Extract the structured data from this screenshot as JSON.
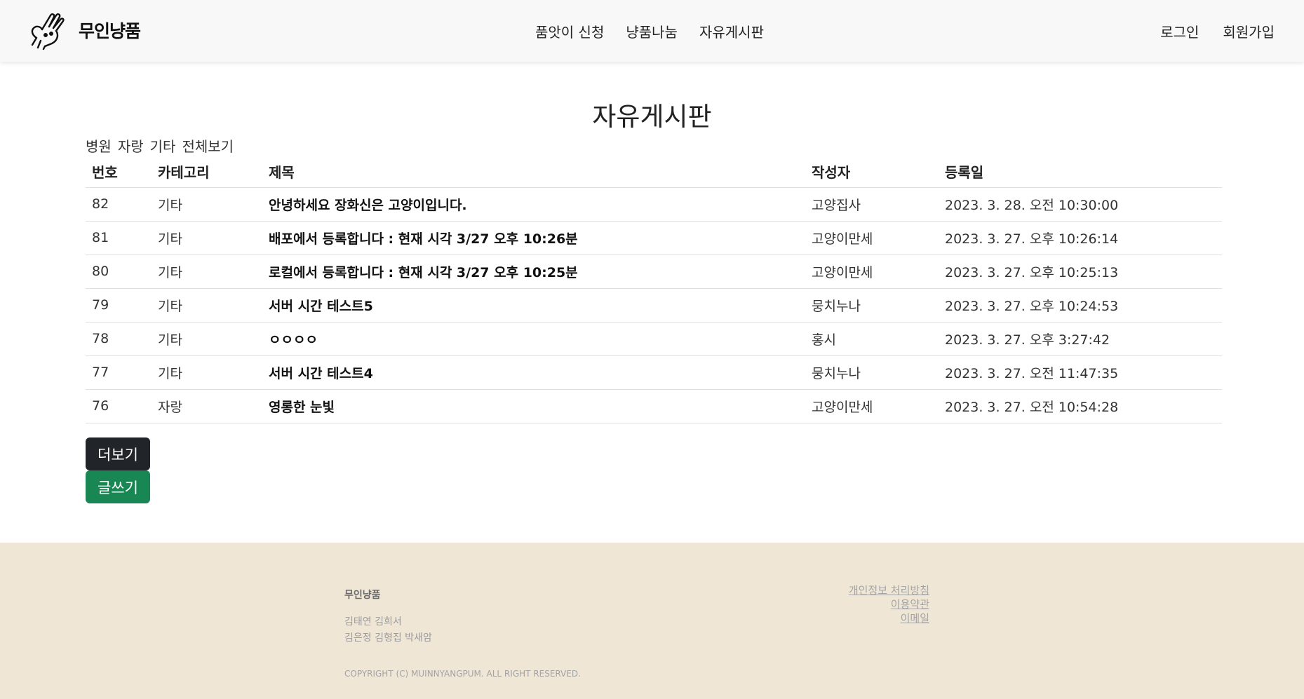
{
  "header": {
    "logo_text": "무인냥품",
    "nav": [
      "품앗이 신청",
      "냥품나눔",
      "자유게시판"
    ],
    "auth": [
      "로그인",
      "회원가입"
    ]
  },
  "main": {
    "title": "자유게시판",
    "filters": [
      "병원",
      "자랑",
      "기타",
      "전체보기"
    ],
    "table": {
      "headers": [
        "번호",
        "카테고리",
        "제목",
        "작성자",
        "등록일"
      ],
      "rows": [
        {
          "no": "82",
          "category": "기타",
          "title": "안녕하세요 장화신은 고양이입니다.",
          "author": "고양집사",
          "date": "2023. 3. 28. 오전 10:30:00"
        },
        {
          "no": "81",
          "category": "기타",
          "title": "배포에서 등록합니다 : 현재 시각 3/27 오후 10:26분",
          "author": "고양이만세",
          "date": "2023. 3. 27. 오후 10:26:14"
        },
        {
          "no": "80",
          "category": "기타",
          "title": "로컬에서 등록합니다 : 현재 시각 3/27 오후 10:25분",
          "author": "고양이만세",
          "date": "2023. 3. 27. 오후 10:25:13"
        },
        {
          "no": "79",
          "category": "기타",
          "title": "서버 시간 테스트5",
          "author": "뭉치누나",
          "date": "2023. 3. 27. 오후 10:24:53"
        },
        {
          "no": "78",
          "category": "기타",
          "title": "ㅇㅇㅇㅇ",
          "author": "홍시",
          "date": "2023. 3. 27. 오후 3:27:42"
        },
        {
          "no": "77",
          "category": "기타",
          "title": "서버 시간 테스트4",
          "author": "뭉치누나",
          "date": "2023. 3. 27. 오전 11:47:35"
        },
        {
          "no": "76",
          "category": "자랑",
          "title": "영롱한 눈빛",
          "author": "고양이만세",
          "date": "2023. 3. 27. 오전 10:54:28"
        }
      ]
    },
    "more_button": "더보기",
    "write_button": "글쓰기"
  },
  "footer": {
    "brand": "무인냥품",
    "members_line1": "김태연 김희서",
    "members_line2": "김은정 김형집 박새암",
    "copyright": "COPYRIGHT (C) MUINNYANGPUM. ALL RIGHT RESERVED.",
    "links": [
      "개인정보 처리방침",
      "이용약관",
      "이메일"
    ]
  },
  "colors": {
    "header_bg": "#f8f8f8",
    "footer_bg": "#efe6d6",
    "more_button": "#212529",
    "write_button": "#198754"
  }
}
